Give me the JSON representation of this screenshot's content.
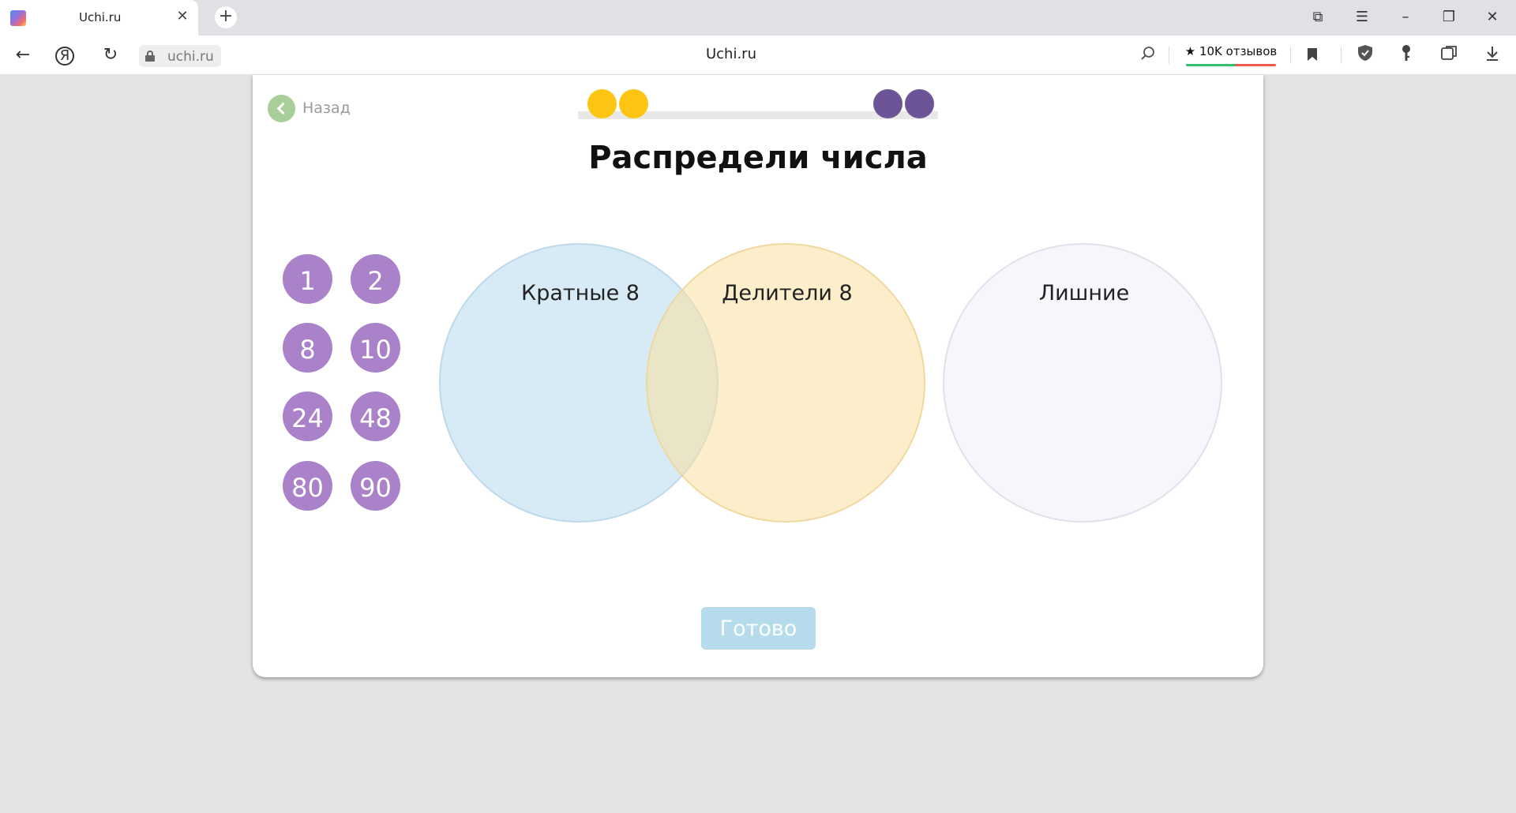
{
  "browser": {
    "tab": {
      "title": "Uchi.ru",
      "close_glyph": "✕"
    },
    "new_tab_glyph": "+",
    "window_controls": {
      "collections": "⧉",
      "menu": "☰",
      "minimize": "–",
      "restore": "❐",
      "close": "✕"
    },
    "nav": {
      "back": "←",
      "yandex": "Я",
      "reload": "↻"
    },
    "url": "uchi.ru",
    "page_host": "Uchi.ru",
    "reviews_label": "★ 10K отзывов",
    "icons": [
      "zoom-icon",
      "bookmark-icon",
      "shield-icon",
      "key-icon",
      "extensions-icon",
      "download-icon"
    ]
  },
  "app": {
    "back_label": "Назад",
    "progress": {
      "completed": 2,
      "remaining": 2,
      "completed_color": "#fcc514",
      "remaining_color": "#6c5497"
    },
    "title": "Распредели числа",
    "numbers": [
      "1",
      "2",
      "8",
      "10",
      "24",
      "48",
      "80",
      "90"
    ],
    "zones": {
      "multiples": "Кратные 8",
      "divisors": "Делители 8",
      "extra": "Лишние"
    },
    "done_label": "Готово",
    "colors": {
      "chip": "#a982c9",
      "done_button": "#b5dbec",
      "back_button": "#a8cf9a"
    }
  }
}
